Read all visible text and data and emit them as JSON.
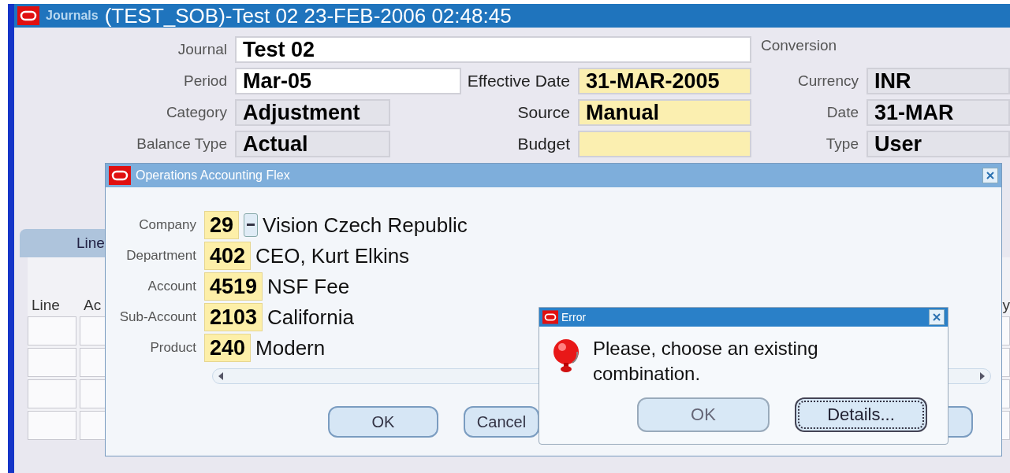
{
  "main_window": {
    "app_name": "Journals",
    "title": "(TEST_SOB)-Test 02 23-FEB-2006 02:48:45",
    "journal": {
      "label": "Journal",
      "value": "Test 02",
      "kind": "text"
    },
    "fields_left": [
      {
        "label": "Period",
        "value": "Mar-05",
        "kind": "text"
      },
      {
        "label": "Category",
        "value": "Adjustment",
        "kind": "readonly"
      },
      {
        "label": "Balance Type",
        "value": "Actual",
        "kind": "readonly"
      }
    ],
    "fields_middle": [
      {
        "label": "Effective Date",
        "value": "31-MAR-2005",
        "kind": "required"
      },
      {
        "label": "Source",
        "value": "Manual",
        "kind": "required"
      },
      {
        "label": "Budget",
        "kind": "required"
      }
    ],
    "conversion": {
      "title": "Conversion",
      "fields": [
        {
          "label": "Currency",
          "value": "INR",
          "kind": "readonly"
        },
        {
          "label": "Date",
          "value": "31-MAR",
          "kind": "readonly"
        },
        {
          "label": "Type",
          "value": "User",
          "kind": "readonly"
        }
      ]
    },
    "lines_tab": {
      "label": "Line"
    },
    "table": {
      "columns": [
        "Line",
        "Ac",
        "y"
      ]
    }
  },
  "flex_dialog": {
    "title": "Operations Accounting Flex",
    "segments": [
      {
        "label": "Company",
        "value": "29",
        "description": "Vision Czech Republic",
        "lov_button": true
      },
      {
        "label": "Department",
        "value": "402",
        "description": "CEO, Kurt Elkins",
        "lov_button": false
      },
      {
        "label": "Account",
        "value": "4519",
        "description": "NSF Fee",
        "lov_button": false
      },
      {
        "label": "Sub-Account",
        "value": "2103",
        "description": "California",
        "lov_button": false
      },
      {
        "label": "Product",
        "value": "240",
        "description": "Modern",
        "lov_button": false
      }
    ],
    "buttons": [
      "OK",
      "Cancel"
    ]
  },
  "error_dialog": {
    "title": "Error",
    "message": "Please, choose an existing combination.",
    "buttons": [
      {
        "label": "OK",
        "focused": false
      },
      {
        "label": "Details...",
        "focused": true
      }
    ]
  }
}
